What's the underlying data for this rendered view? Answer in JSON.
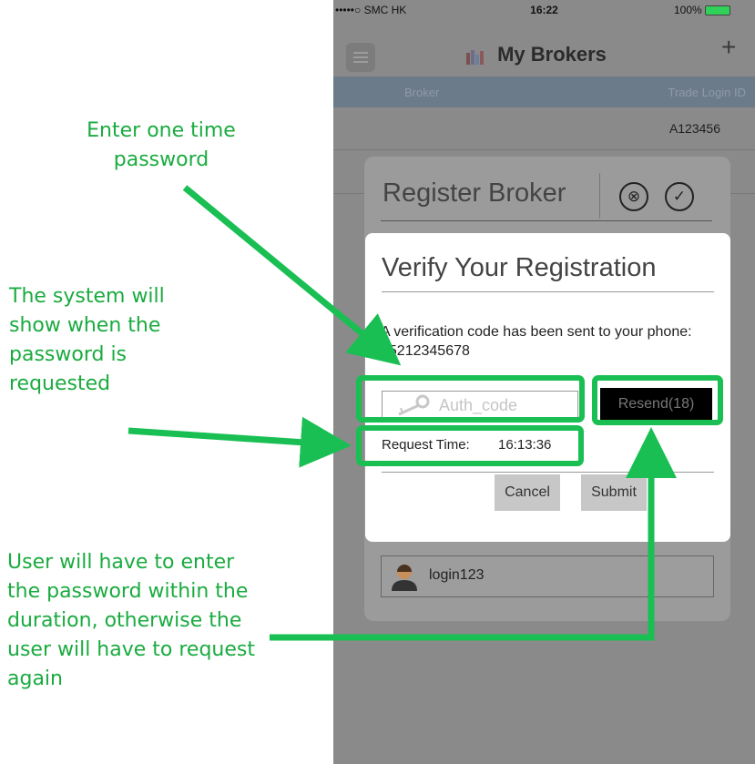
{
  "annotations": {
    "otp": "Enter one time password",
    "request_time": "The system will show when the password is requested",
    "duration": "User will have to enter the password within the duration, otherwise the user will have to request again"
  },
  "status_bar": {
    "carrier": "•••••○ SMC HK",
    "time": "16:22",
    "battery": "100%"
  },
  "nav": {
    "title": "My Brokers",
    "add": "+"
  },
  "table": {
    "headers": [
      "Broker",
      "Trade Login ID"
    ],
    "rows": [
      {
        "broker": "",
        "login_id": "A123456"
      }
    ]
  },
  "register": {
    "title": "Register Broker",
    "close": "⊗",
    "confirm": "✓",
    "login": "login123"
  },
  "dialog": {
    "title": "Verify Your Registration",
    "message": "A verification code has been sent to your phone: 85212345678",
    "auth_placeholder": "Auth_code",
    "resend_label": "Resend(18)",
    "request_time_label": "Request Time:",
    "request_time_value": "16:13:36",
    "cancel_label": "Cancel",
    "submit_label": "Submit"
  },
  "colors": {
    "annotation_green": "#1aab40",
    "highlight_green": "#19bf53"
  }
}
